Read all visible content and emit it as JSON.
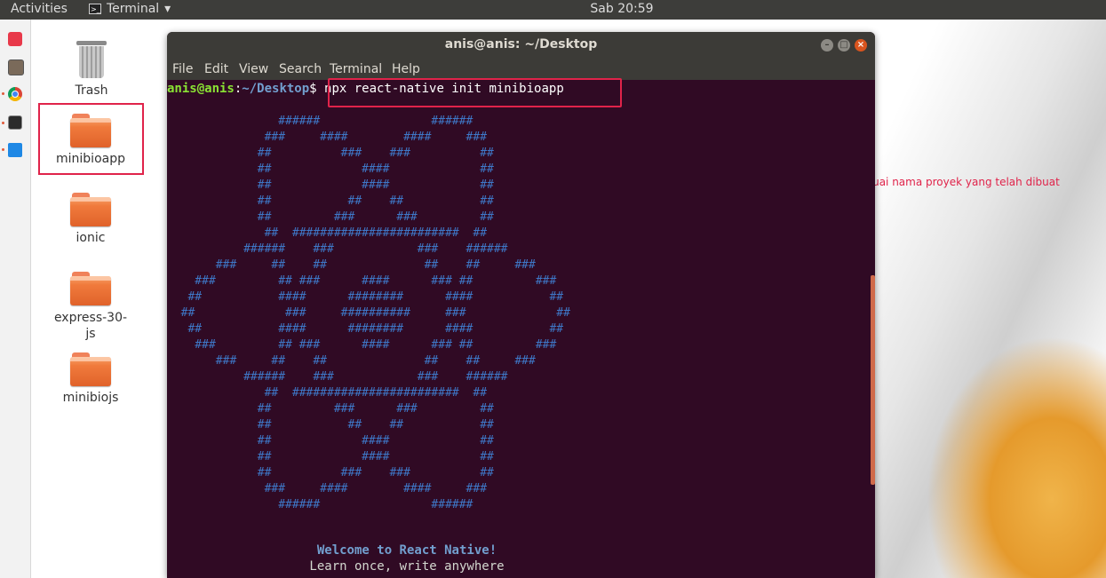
{
  "topbar": {
    "activities": "Activities",
    "app_name": "Terminal",
    "app_menu_arrow": "▾",
    "clock": "Sab 20:59"
  },
  "dock": {
    "icons": [
      "software-center-icon",
      "files-icon",
      "chrome-icon",
      "terminal-icon",
      "vscode-icon"
    ]
  },
  "desktop": {
    "icons": [
      {
        "label": "Trash"
      },
      {
        "label": "minibioapp"
      },
      {
        "label": "ionic"
      },
      {
        "label": "express-30-\njs"
      },
      {
        "label": "minibiojs"
      }
    ]
  },
  "terminal": {
    "title": "anis@anis: ~/Desktop",
    "menu": [
      "File",
      "Edit",
      "View",
      "Search",
      "Terminal",
      "Help"
    ],
    "prompt_user": "anis@anis",
    "prompt_sep": ":",
    "prompt_path": "~/Desktop",
    "prompt_dollar": "$",
    "command": " npx react-native init minibioapp",
    "ascii_art": [
      "                ######                ######",
      "              ###     ####        ####     ###",
      "             ##          ###    ###          ##",
      "             ##             ####             ##",
      "             ##             ####             ##",
      "             ##           ##    ##           ##",
      "             ##         ###      ###         ##",
      "              ##  ########################  ##",
      "           ######    ###            ###    ######",
      "       ###     ##    ##              ##    ##     ###",
      "    ###         ## ###      ####      ### ##         ###",
      "   ##           ####      ########      ####           ##",
      "  ##             ###     ##########     ###             ##",
      "   ##           ####      ########      ####           ##",
      "    ###         ## ###      ####      ### ##         ###",
      "       ###     ##    ##              ##    ##     ###",
      "           ######    ###            ###    ######",
      "              ##  ########################  ##",
      "             ##         ###      ###         ##",
      "             ##           ##    ##           ##",
      "             ##             ####             ##",
      "             ##             ####             ##",
      "             ##          ###    ###          ##",
      "              ###     ####        ####     ###",
      "                ######                ######"
    ],
    "welcome": "Welcome to React Native!",
    "tagline": "Learn once, write anywhere"
  },
  "annotation": "akan menghasilkan folder sesuai nama proyek yang telah dibuat",
  "colors": {
    "highlight_red": "#e0234a",
    "terminal_bg": "#300a24",
    "prompt_green": "#8ae234",
    "prompt_blue": "#729fcf"
  }
}
